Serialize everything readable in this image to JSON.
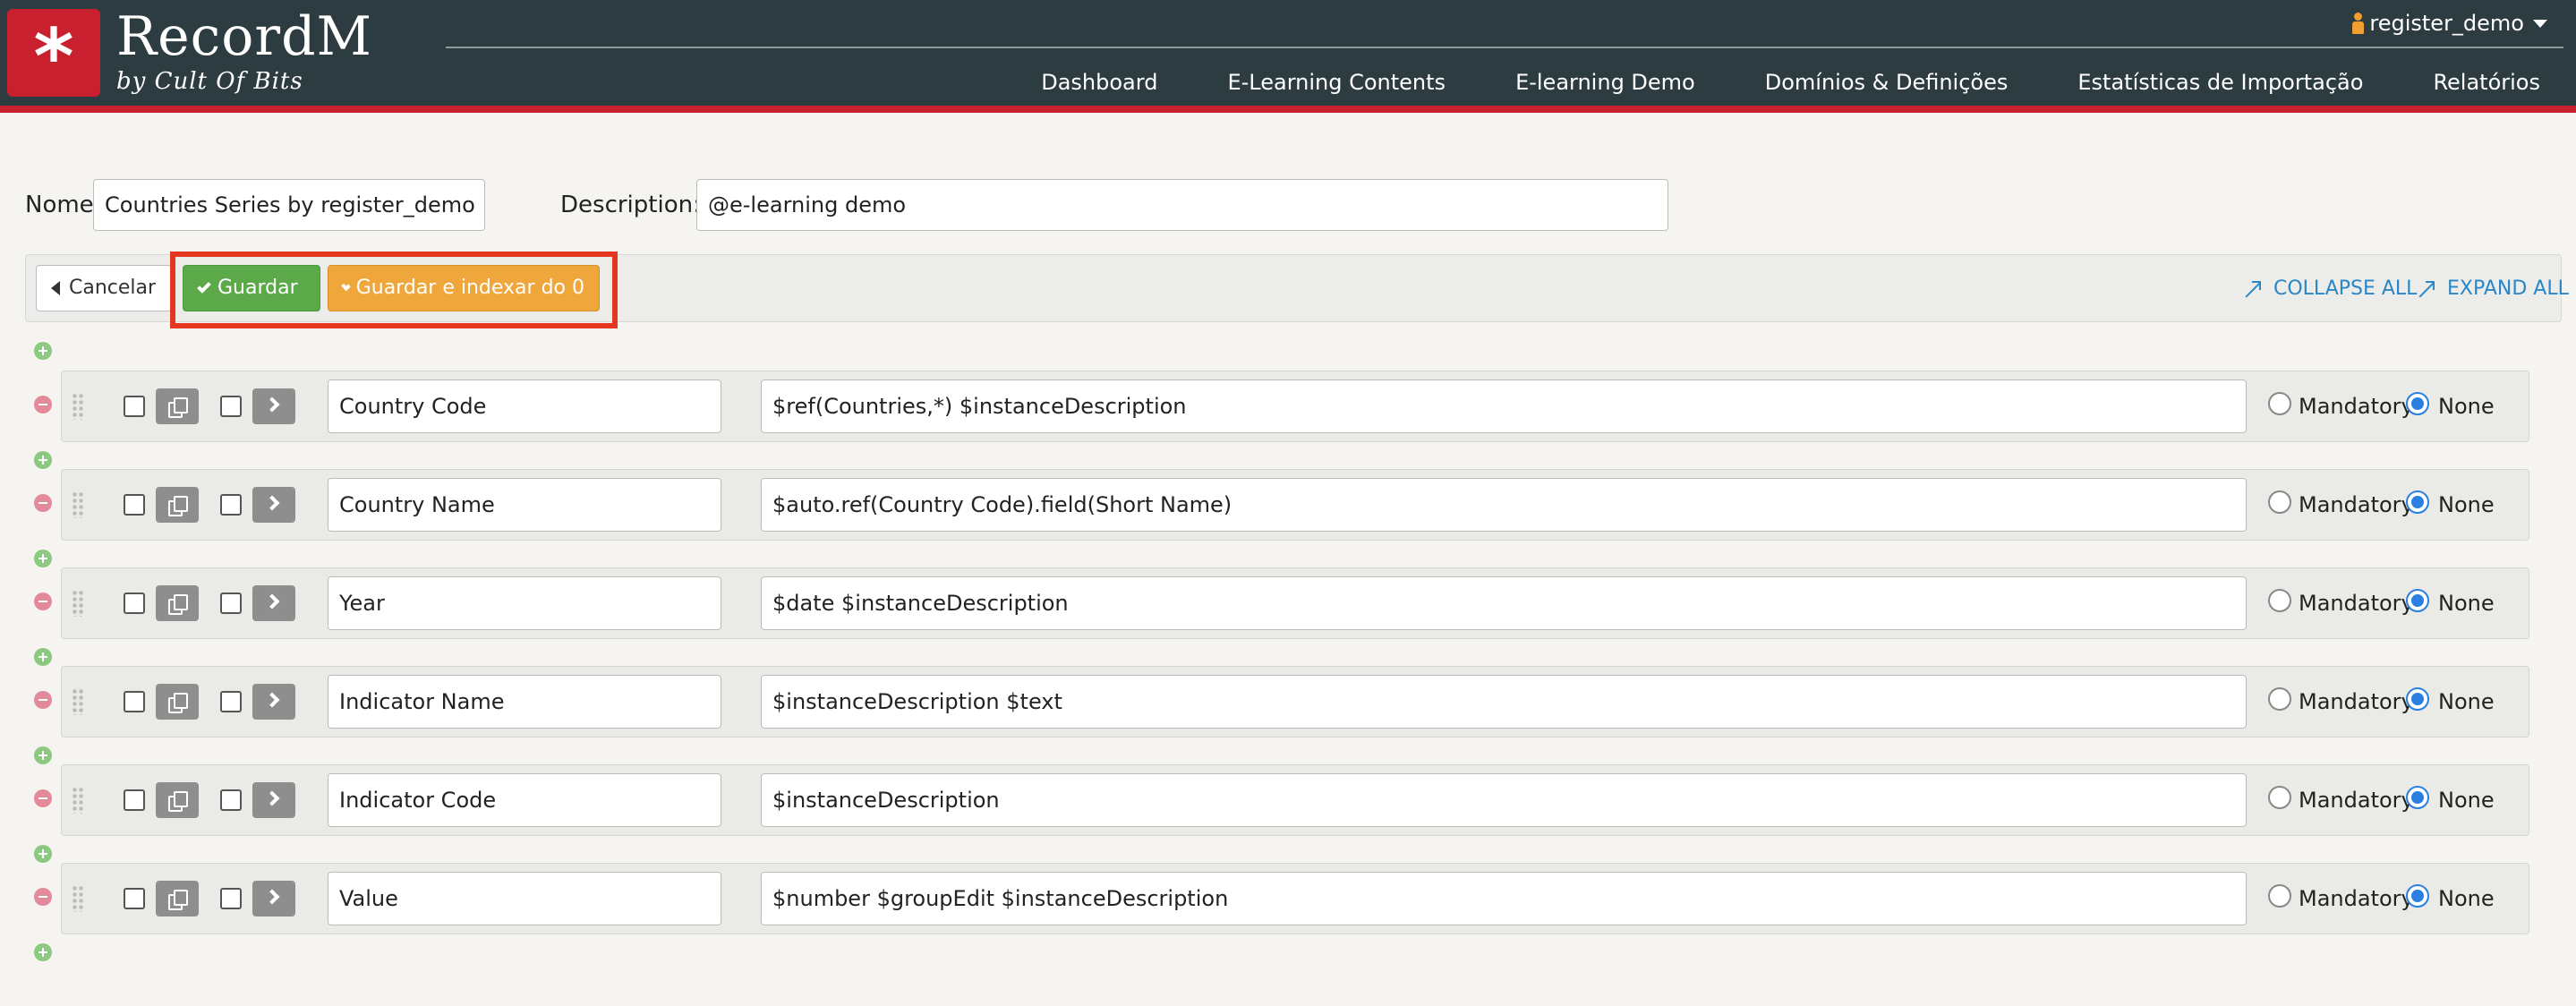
{
  "app": {
    "name": "RecordM",
    "tagline": "by Cult Of Bits",
    "user": "register_demo",
    "brand_color": "#c8202f"
  },
  "nav": {
    "items": [
      "Dashboard",
      "E-Learning Contents",
      "E-learning Demo",
      "Domínios & Definições",
      "Estatísticas de Importação",
      "Relatórios"
    ]
  },
  "form": {
    "name_label": "Nome",
    "name_value": "Countries Series by register_demo",
    "description_label": "Description:",
    "description_value": "@e-learning demo"
  },
  "toolbar": {
    "cancel_label": "Cancelar",
    "save_label": "Guardar",
    "save_index_label": "Guardar e indexar do 0",
    "collapse_all_label": "COLLAPSE ALL",
    "expand_all_label": "EXPAND ALL"
  },
  "fields": [
    {
      "name": "Country Code",
      "description": "$ref(Countries,*) $instanceDescription",
      "mandatory": false
    },
    {
      "name": "Country Name",
      "description": "$auto.ref(Country Code).field(Short Name)",
      "mandatory": false
    },
    {
      "name": "Year",
      "description": "$date $instanceDescription",
      "mandatory": false
    },
    {
      "name": "Indicator Name",
      "description": "$instanceDescription $text",
      "mandatory": false
    },
    {
      "name": "Indicator Code",
      "description": "$instanceDescription",
      "mandatory": false
    },
    {
      "name": "Value",
      "description": "$number $groupEdit $instanceDescription",
      "mandatory": false
    }
  ],
  "radio_labels": {
    "mandatory": "Mandatory",
    "none": "None"
  }
}
